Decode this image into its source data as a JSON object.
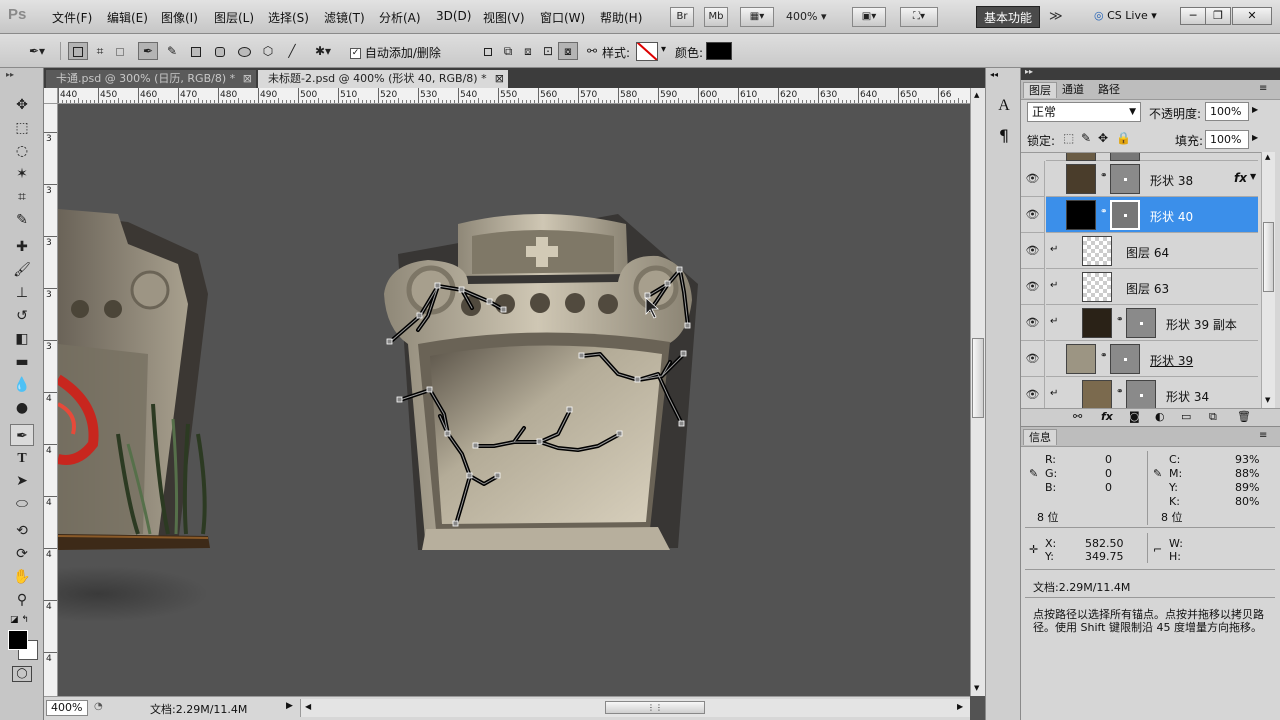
{
  "app": {
    "logo": "Ps"
  },
  "menu": {
    "items": [
      "文件(F)",
      "编辑(E)",
      "图像(I)",
      "图层(L)",
      "选择(S)",
      "滤镜(T)",
      "分析(A)",
      "3D(D)",
      "视图(V)",
      "窗口(W)",
      "帮助(H)"
    ],
    "bridge": "Br",
    "minibridge": "Mb",
    "zoom": "400%",
    "workspace": "基本功能",
    "cs_live": "CS Live"
  },
  "options": {
    "auto_add_delete": "自动添加/删除",
    "style_label": "样式:",
    "color_label": "颜色:",
    "color_value": "#000000"
  },
  "tabs": [
    {
      "label": "卡通.psd @ 300% (日历, RGB/8) *",
      "active": false
    },
    {
      "label": "未标题-2.psd @ 400% (形状 40, RGB/8) *",
      "active": true
    }
  ],
  "ruler": {
    "h_ticks": [
      "440",
      "450",
      "460",
      "470",
      "480",
      "490",
      "500",
      "510",
      "520",
      "530",
      "540",
      "550",
      "560",
      "570",
      "580",
      "590",
      "600",
      "610",
      "620",
      "630",
      "640",
      "650",
      "66"
    ],
    "v_ticks": [
      "3",
      "3",
      "3",
      "3",
      "3",
      "4",
      "4",
      "4",
      "4",
      "4",
      "4"
    ]
  },
  "status": {
    "zoom": "400%",
    "doc": "文档:2.29M/11.4M"
  },
  "layers_panel": {
    "tabs": [
      "图层",
      "通道",
      "路径"
    ],
    "blend_mode": "正常",
    "opacity_label": "不透明度:",
    "opacity": "100%",
    "lock_label": "锁定:",
    "fill_label": "填充:",
    "fill": "100%",
    "layers": [
      {
        "name": "形状 38",
        "thumb": "#4a3d2b",
        "mask": true,
        "fx": "fx",
        "selected": false,
        "clipped": false
      },
      {
        "name": "形状 40",
        "thumb": "#000000",
        "mask": true,
        "fx": "",
        "selected": true,
        "clipped": false
      },
      {
        "name": "图层 64",
        "thumb": "checker",
        "mask": false,
        "fx": "",
        "selected": false,
        "clipped": true
      },
      {
        "name": "图层 63",
        "thumb": "checker",
        "mask": false,
        "fx": "",
        "selected": false,
        "clipped": true
      },
      {
        "name": "形状 39 副本",
        "thumb": "#2a2217",
        "mask": true,
        "fx": "",
        "selected": false,
        "clipped": true
      },
      {
        "name": "形状 39",
        "thumb": "#9c9583",
        "mask": true,
        "fx": "",
        "selected": false,
        "clipped": false
      },
      {
        "name": "形状 34",
        "thumb": "#7b6a4e",
        "mask": true,
        "fx": "",
        "selected": false,
        "clipped": true
      }
    ]
  },
  "info_panel": {
    "tab": "信息",
    "r_label": "R:",
    "r": "0",
    "g_label": "G:",
    "g": "0",
    "b_label": "B:",
    "b": "0",
    "c_label": "C:",
    "c": "93%",
    "m_label": "M:",
    "m": "88%",
    "y_label": "Y:",
    "y": "89%",
    "k_label": "K:",
    "k": "80%",
    "bit_left": "8 位",
    "bit_right": "8 位",
    "x_label": "X:",
    "x": "582.50",
    "ypos_label": "Y:",
    "ypos": "349.75",
    "w_label": "W:",
    "h_label": "H:",
    "doc": "文档:2.29M/11.4M",
    "hint": "点按路径以选择所有锚点。点按并拖移以拷贝路径。使用 Shift 键限制沿 45 度增量方向拖移。"
  }
}
